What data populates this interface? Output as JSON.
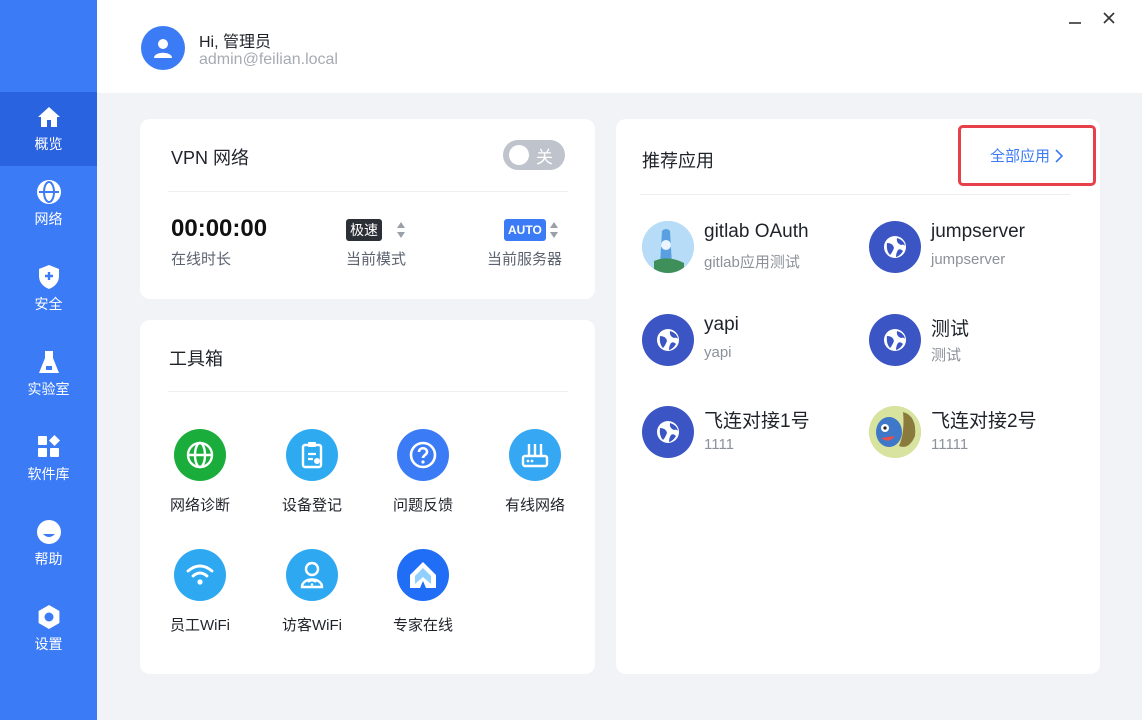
{
  "sidebar": {
    "items": [
      {
        "label": "概览",
        "icon": "home-icon"
      },
      {
        "label": "网络",
        "icon": "globe-icon"
      },
      {
        "label": "安全",
        "icon": "shield-icon"
      },
      {
        "label": "实验室",
        "icon": "flask-icon"
      },
      {
        "label": "软件库",
        "icon": "apps-grid-icon"
      },
      {
        "label": "帮助",
        "icon": "help-icon"
      },
      {
        "label": "设置",
        "icon": "gear-icon"
      }
    ],
    "active_index": 0
  },
  "header": {
    "greeting": "Hi, 管理员",
    "email": "admin@feilian.local"
  },
  "window_controls": {
    "minimize": "minimize-icon",
    "close": "close-icon"
  },
  "vpn": {
    "title": "VPN 网络",
    "toggle_label": "关",
    "toggle_on": false,
    "duration": "00:00:00",
    "duration_label": "在线时长",
    "mode_tag": "极速",
    "mode_label": "当前模式",
    "server_tag": "AUTO",
    "server_label": "当前服务器"
  },
  "toolbox": {
    "title": "工具箱",
    "tools": [
      {
        "label": "网络诊断",
        "icon": "globe-icon",
        "color": "#1aad3b"
      },
      {
        "label": "设备登记",
        "icon": "clipboard-icon",
        "color": "#2eaaf0"
      },
      {
        "label": "问题反馈",
        "icon": "question-icon",
        "color": "#3c7bf6"
      },
      {
        "label": "有线网络",
        "icon": "router-icon",
        "color": "#36a8f3"
      },
      {
        "label": "员工WiFi",
        "icon": "wifi-icon",
        "color": "#2ea8f0"
      },
      {
        "label": "访客WiFi",
        "icon": "guest-wifi-icon",
        "color": "#2ea8f0"
      },
      {
        "label": "专家在线",
        "icon": "expert-logo-icon",
        "color": "#1f6ef5"
      }
    ]
  },
  "apps": {
    "title": "推荐应用",
    "all_label": "全部应用",
    "items": [
      {
        "name": "gitlab OAuth",
        "desc": "gitlab应用测试",
        "icon": "custom-image-icon"
      },
      {
        "name": "jumpserver",
        "desc": "jumpserver",
        "icon": "app-globe-icon"
      },
      {
        "name": "yapi",
        "desc": "yapi",
        "icon": "app-globe-icon"
      },
      {
        "name": "测试",
        "desc": "测试",
        "icon": "app-globe-icon"
      },
      {
        "name": "飞连对接1号",
        "desc": "1111",
        "icon": "app-globe-icon"
      },
      {
        "name": "飞连对接2号",
        "desc": "11111",
        "icon": "custom-image-icon"
      }
    ]
  },
  "colors": {
    "brand": "#3c7bf6",
    "active_nav": "#2a63e0",
    "highlight_border": "#e8404a",
    "app_icon": "#3b56c4"
  }
}
